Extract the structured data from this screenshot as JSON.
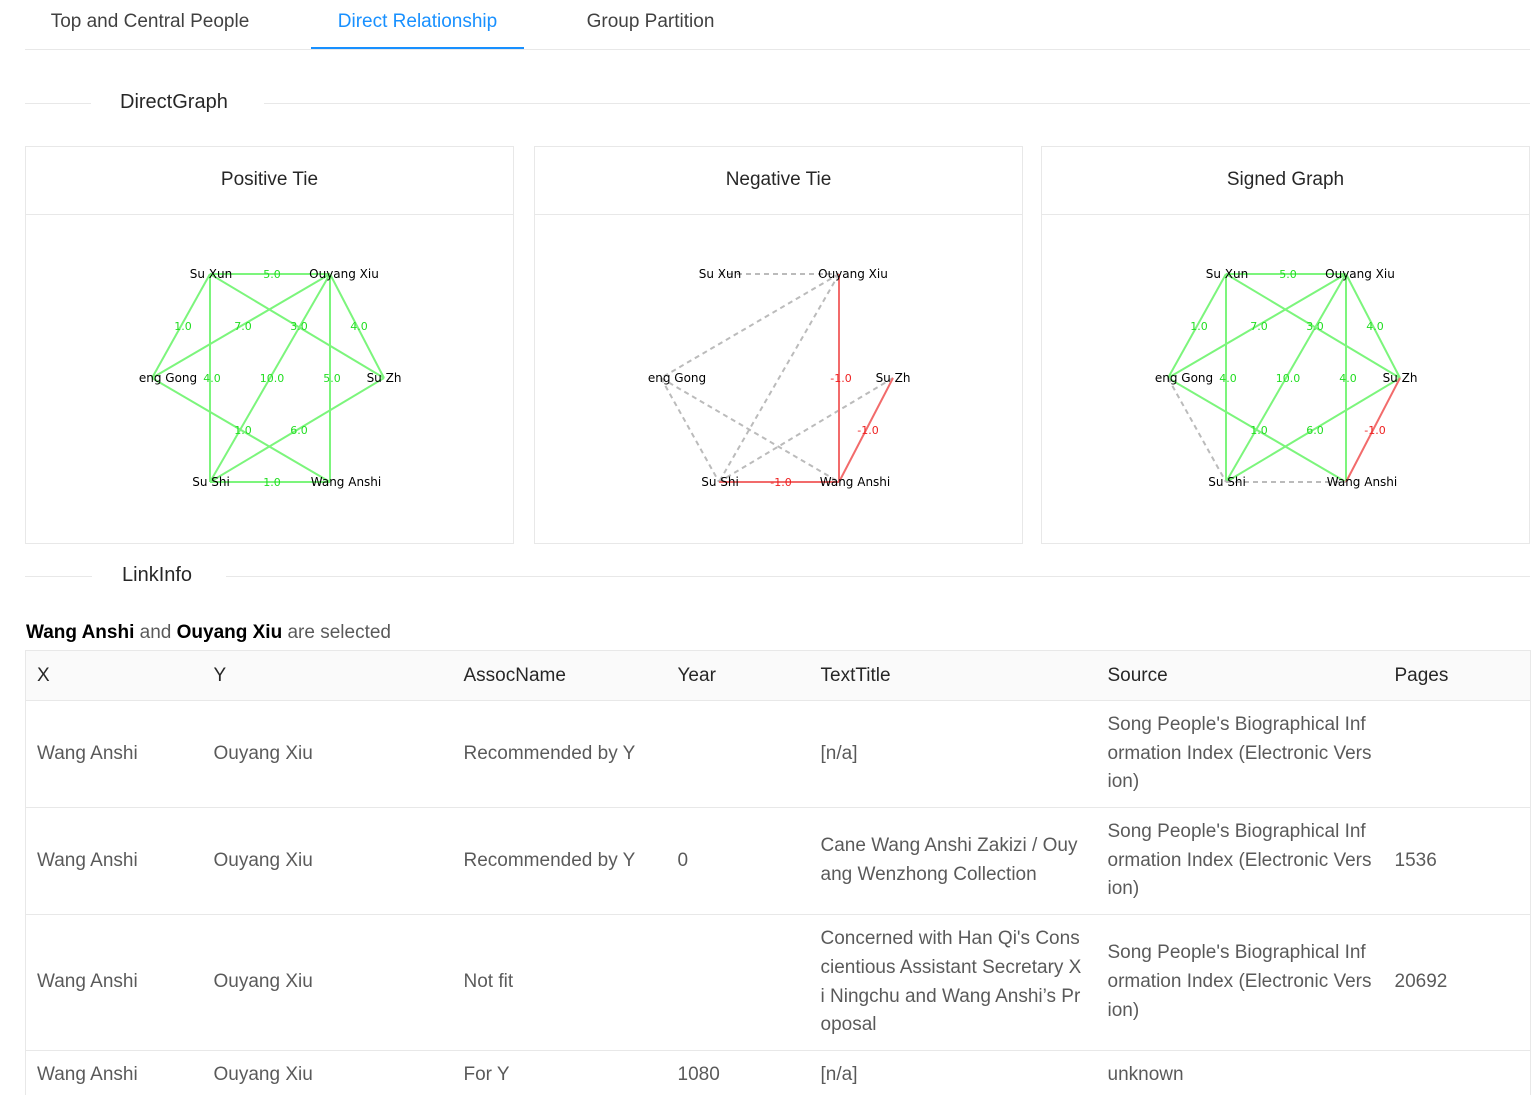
{
  "tabs": [
    {
      "label": "Top and Central People"
    },
    {
      "label": "Direct Relationship"
    },
    {
      "label": "Group Partition"
    }
  ],
  "sections": {
    "graph_title": "DirectGraph",
    "link_title": "LinkInfo"
  },
  "colors": {
    "accent": "#1890ff",
    "positive_edge": "#7cf57c",
    "positive_label": "#22dd22",
    "negative_edge": "#f26b6b",
    "negative_label": "#ee2222",
    "neutral_edge": "#bbbbbb"
  },
  "graph": {
    "nodes": {
      "sx": "Su Xun",
      "oy": "Ouyang Xiu",
      "zg": "eng Gong",
      "sz": "Su Zh",
      "ss": "Su Shi",
      "wa": "Wang Anshi"
    },
    "cards": [
      {
        "title": "Positive Tie",
        "edges": [
          {
            "a": "sx",
            "b": "oy",
            "kind": "pos",
            "label": "5.0"
          },
          {
            "a": "sx",
            "b": "zg",
            "kind": "pos",
            "label": "1.0"
          },
          {
            "a": "oy",
            "b": "zg",
            "kind": "pos",
            "label": "7.0"
          },
          {
            "a": "sx",
            "b": "sz",
            "kind": "pos",
            "label": "3.0"
          },
          {
            "a": "oy",
            "b": "sz",
            "kind": "pos",
            "label": "4.0"
          },
          {
            "a": "sx",
            "b": "ss",
            "kind": "pos",
            "label": "4.0"
          },
          {
            "a": "oy",
            "b": "ss",
            "kind": "pos",
            "label": "10.0"
          },
          {
            "a": "oy",
            "b": "wa",
            "kind": "pos",
            "label": "5.0"
          },
          {
            "a": "zg",
            "b": "wa",
            "kind": "pos",
            "label": "1.0"
          },
          {
            "a": "sz",
            "b": "ss",
            "kind": "pos",
            "label": "6.0"
          },
          {
            "a": "ss",
            "b": "wa",
            "kind": "pos",
            "label": "1.0"
          }
        ]
      },
      {
        "title": "Negative Tie",
        "edges": [
          {
            "a": "sx",
            "b": "oy",
            "kind": "none",
            "label": ""
          },
          {
            "a": "oy",
            "b": "zg",
            "kind": "none",
            "label": ""
          },
          {
            "a": "oy",
            "b": "ss",
            "kind": "none",
            "label": ""
          },
          {
            "a": "zg",
            "b": "ss",
            "kind": "none",
            "label": ""
          },
          {
            "a": "zg",
            "b": "wa",
            "kind": "none",
            "label": ""
          },
          {
            "a": "sz",
            "b": "ss",
            "kind": "none",
            "label": ""
          },
          {
            "a": "oy",
            "b": "wa",
            "kind": "neg",
            "label": "-1.0"
          },
          {
            "a": "sz",
            "b": "wa",
            "kind": "neg",
            "label": "-1.0"
          },
          {
            "a": "ss",
            "b": "wa",
            "kind": "neg",
            "label": "-1.0"
          }
        ]
      },
      {
        "title": "Signed Graph",
        "edges": [
          {
            "a": "sx",
            "b": "oy",
            "kind": "pos",
            "label": "5.0"
          },
          {
            "a": "sx",
            "b": "zg",
            "kind": "pos",
            "label": "1.0"
          },
          {
            "a": "oy",
            "b": "zg",
            "kind": "pos",
            "label": "7.0"
          },
          {
            "a": "sx",
            "b": "sz",
            "kind": "pos",
            "label": "3.0"
          },
          {
            "a": "oy",
            "b": "sz",
            "kind": "pos",
            "label": "4.0"
          },
          {
            "a": "sx",
            "b": "ss",
            "kind": "pos",
            "label": "4.0"
          },
          {
            "a": "oy",
            "b": "ss",
            "kind": "pos",
            "label": "10.0"
          },
          {
            "a": "oy",
            "b": "wa",
            "kind": "pos",
            "label": "4.0"
          },
          {
            "a": "zg",
            "b": "wa",
            "kind": "pos",
            "label": "1.0"
          },
          {
            "a": "sz",
            "b": "ss",
            "kind": "pos",
            "label": "6.0"
          },
          {
            "a": "zg",
            "b": "ss",
            "kind": "none",
            "label": ""
          },
          {
            "a": "ss",
            "b": "wa",
            "kind": "none",
            "label": ""
          },
          {
            "a": "sz",
            "b": "wa",
            "kind": "neg",
            "label": "-1.0"
          }
        ]
      }
    ]
  },
  "selection": {
    "person_a": "Wang Anshi",
    "and_text": "and",
    "person_b": "Ouyang Xiu",
    "suffix": "are selected"
  },
  "table": {
    "headers": [
      "X",
      "Y",
      "AssocName",
      "Year",
      "TextTitle",
      "Source",
      "Pages"
    ],
    "rows": [
      [
        "Wang Anshi",
        "Ouyang Xiu",
        "Recommended by Y",
        "",
        "[n/a]",
        "Song People's Biographical Information Index (Electronic Version)",
        ""
      ],
      [
        "Wang Anshi",
        "Ouyang Xiu",
        "Recommended by Y",
        "0",
        "Cane Wang Anshi Zakizi / Ouyang Wenzhong Collection",
        "Song People's Biographical Information Index (Electronic Version)",
        "1536"
      ],
      [
        "Wang Anshi",
        "Ouyang Xiu",
        "Not fit",
        "",
        "Concerned with Han Qi's Conscientious Assistant Secretary Xi Ningchu and Wang Anshi’s Proposal",
        "Song People's Biographical Information Index (Electronic Version)",
        "20692"
      ],
      [
        "Wang Anshi",
        "Ouyang Xiu",
        "For Y",
        "1080",
        "[n/a]",
        "unknown",
        ""
      ]
    ]
  }
}
